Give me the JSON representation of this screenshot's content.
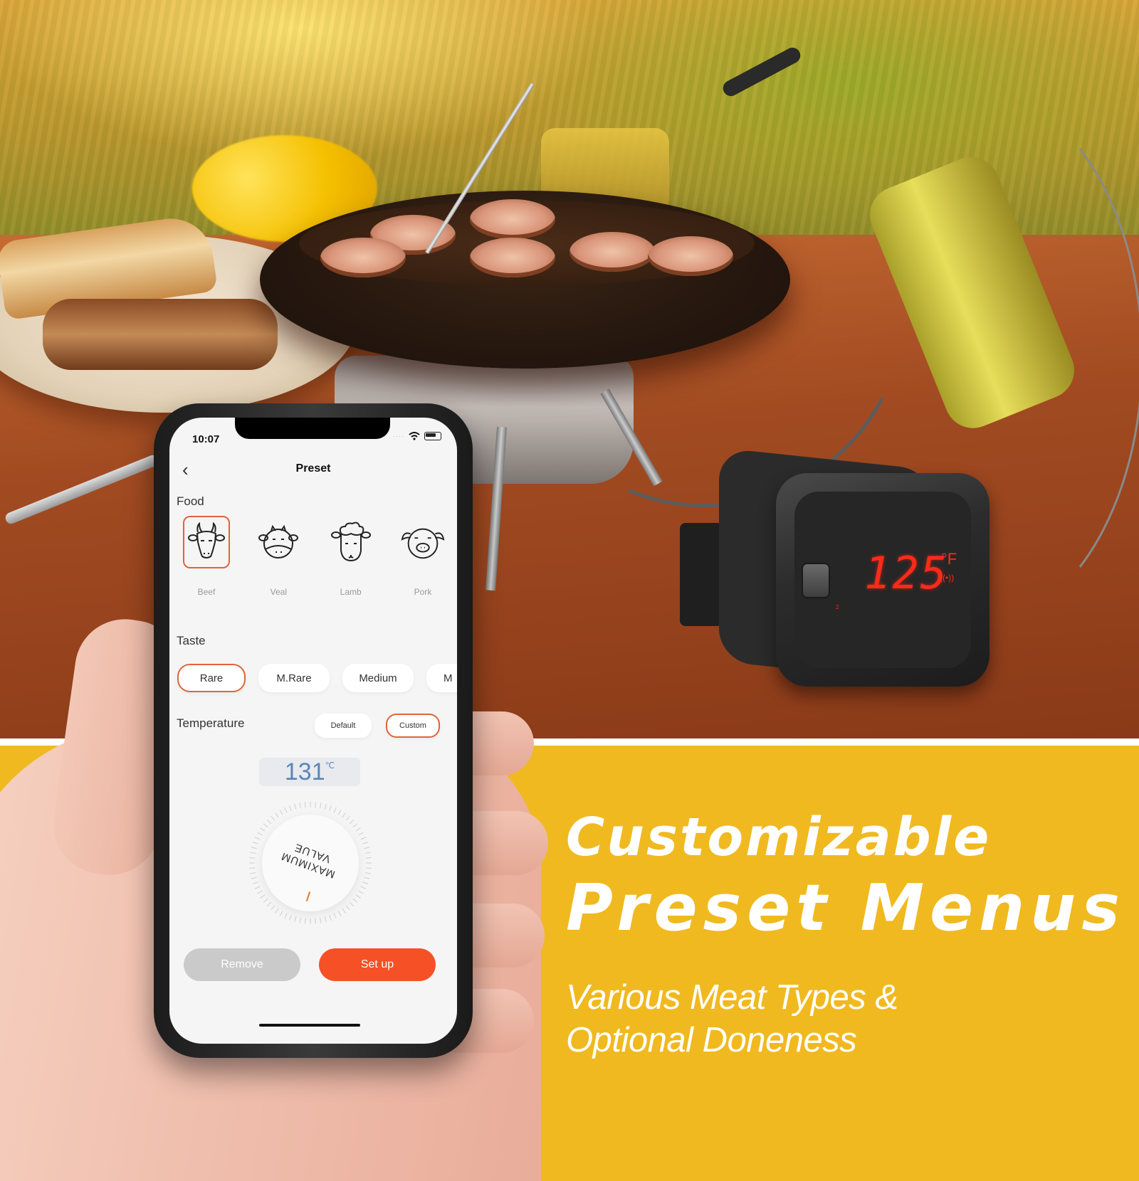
{
  "colors": {
    "banner_yellow": "#f0b920",
    "accent_orange": "#e0643a",
    "setup_button": "#f65027",
    "remove_button": "#cacaca",
    "temp_blue": "#5a86b8",
    "device_led_red": "#ff2a1a"
  },
  "marketing": {
    "headline_line1": "Customizable",
    "headline_line2": "Preset Menus",
    "subhead_line1": "Various Meat Types &",
    "subhead_line2": "Optional Doneness"
  },
  "device": {
    "display_value": "125",
    "display_unit": "°F",
    "signal_icon": "signal-waves-icon",
    "probe_number": "2"
  },
  "phone": {
    "status_bar": {
      "time": "10:07",
      "signal": "····",
      "wifi_icon": "wifi-icon",
      "battery_icon": "battery-icon"
    },
    "nav": {
      "back_icon": "chevron-left-icon",
      "back_glyph": "‹",
      "title": "Preset"
    },
    "food": {
      "label": "Food",
      "items": [
        {
          "label": "Beef",
          "icon": "cow-icon",
          "selected": true
        },
        {
          "label": "Veal",
          "icon": "calf-icon",
          "selected": false
        },
        {
          "label": "Lamb",
          "icon": "sheep-icon",
          "selected": false
        },
        {
          "label": "Pork",
          "icon": "pig-icon",
          "selected": false
        }
      ]
    },
    "taste": {
      "label": "Taste",
      "options": [
        {
          "label": "Rare",
          "selected": true
        },
        {
          "label": "M.Rare",
          "selected": false
        },
        {
          "label": "Medium",
          "selected": false
        },
        {
          "label": "M",
          "selected": false
        }
      ]
    },
    "temperature": {
      "label": "Temperature",
      "modes": [
        {
          "label": "Default",
          "selected": false
        },
        {
          "label": "Custom",
          "selected": true
        }
      ],
      "value": "131",
      "unit": "℃",
      "dial_text_line1": "MAXIMUM",
      "dial_text_line2": "VALUE"
    },
    "buttons": {
      "remove": "Remove",
      "setup": "Set up"
    }
  }
}
